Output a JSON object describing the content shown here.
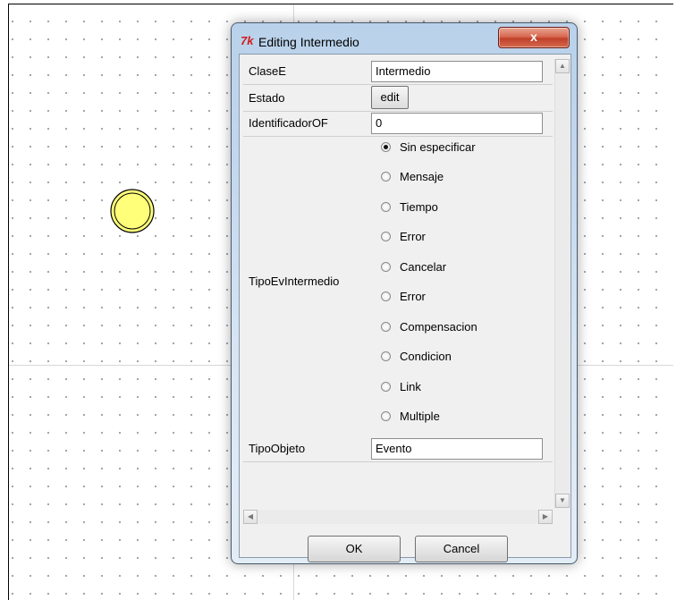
{
  "dialog": {
    "title": "Editing Intermedio",
    "app_icon": "tk-feather-icon",
    "close_label": "x",
    "ok_label": "OK",
    "cancel_label": "Cancel"
  },
  "fields": {
    "clasee": {
      "label": "ClaseE",
      "value": "Intermedio"
    },
    "estado": {
      "label": "Estado",
      "button": "edit"
    },
    "identificador": {
      "label": "IdentificadorOF",
      "value": "0"
    },
    "tipoev": {
      "label": "TipoEvIntermedio",
      "options": [
        "Sin especificar",
        "Mensaje",
        "Tiempo",
        "Error",
        "Cancelar",
        "Error",
        "Compensacion",
        "Condicion",
        "Link",
        "Multiple"
      ],
      "selected": "Sin especificar"
    },
    "tipoobjeto": {
      "label": "TipoObjeto",
      "value": "Evento"
    }
  },
  "colors": {
    "event_fill": "#ffff7a",
    "close_button": "#c8442c",
    "canvas_dots": "#9aa3ad"
  }
}
